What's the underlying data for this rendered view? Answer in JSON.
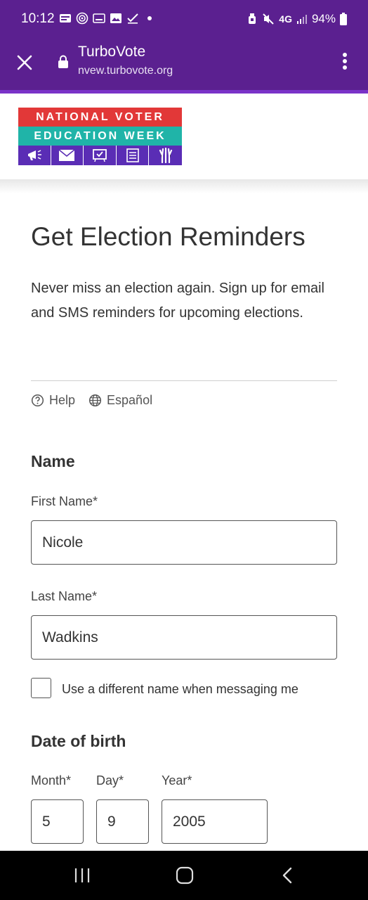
{
  "status_bar": {
    "time": "10:12",
    "battery": "94%",
    "network": "4G",
    "left_icons": [
      "app-badge-icon",
      "radio-icon",
      "screen-icon",
      "image-icon",
      "check-icon",
      "dot-icon"
    ],
    "right_icons": [
      "alarm-icon",
      "mute-icon",
      "signal-icon",
      "battery-icon"
    ]
  },
  "browser": {
    "title": "TurboVote",
    "url": "nvew.turbovote.org"
  },
  "logo": {
    "line1": "NATIONAL VOTER",
    "line2": "EDUCATION WEEK",
    "colors": {
      "red": "#e23838",
      "teal": "#20b4a8",
      "purple": "#5a2db5"
    }
  },
  "page": {
    "title": "Get Election Reminders",
    "intro": "Never miss an election again. Sign up for email and SMS reminders for upcoming elections.",
    "help_label": "Help",
    "language_label": "Español"
  },
  "form": {
    "name_heading": "Name",
    "first_name_label": "First Name*",
    "first_name_value": "Nicole",
    "last_name_label": "Last Name*",
    "last_name_value": "Wadkins",
    "different_name_label": "Use a different name when messaging me",
    "dob_heading": "Date of birth",
    "month_label": "Month*",
    "month_value": "5",
    "day_label": "Day*",
    "day_value": "9",
    "year_label": "Year*",
    "year_value": "2005"
  },
  "colors": {
    "brand_purple": "#5b2090",
    "accent_purple": "#7a33c8"
  }
}
